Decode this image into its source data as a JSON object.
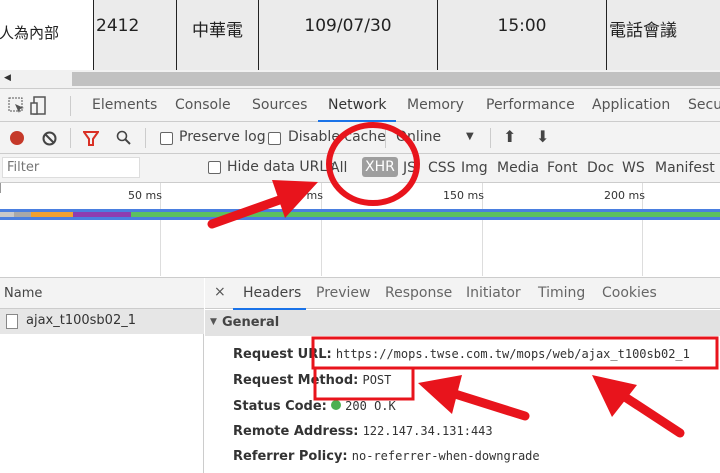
{
  "page_table": {
    "cells": [
      "人為內部",
      "2412",
      "中華電",
      "109/07/30",
      "15:00",
      "電話會議"
    ]
  },
  "devtools": {
    "tabs": [
      "Elements",
      "Console",
      "Sources",
      "Network",
      "Memory",
      "Performance",
      "Application",
      "Secur"
    ],
    "active_tab": "Network",
    "toolbar": {
      "preserve_log": "Preserve log",
      "disable_cache": "Disable cache",
      "throttle": "Online"
    },
    "filter": {
      "placeholder": "Filter",
      "hide_data_urls": "Hide data URLs",
      "types": [
        "All",
        "XHR",
        "JS",
        "CSS",
        "Img",
        "Media",
        "Font",
        "Doc",
        "WS",
        "Manifest"
      ],
      "active_type": "XHR"
    },
    "timeline": {
      "ticks": [
        "50 ms",
        "100 ms",
        "150 ms",
        "200 ms"
      ]
    },
    "requests": {
      "header": "Name",
      "items": [
        "ajax_t100sb02_1"
      ]
    },
    "detail_tabs": [
      "Headers",
      "Preview",
      "Response",
      "Initiator",
      "Timing",
      "Cookies"
    ],
    "general": {
      "title": "General",
      "rows": [
        {
          "label": "Request URL:",
          "value": "https://mops.twse.com.tw/mops/web/ajax_t100sb02_1"
        },
        {
          "label": "Request Method:",
          "value": "POST"
        },
        {
          "label": "Status Code:",
          "value": "200 O.K"
        },
        {
          "label": "Remote Address:",
          "value": "122.147.34.131:443"
        },
        {
          "label": "Referrer Policy:",
          "value": "no-referrer-when-downgrade"
        }
      ]
    }
  },
  "colors": {
    "accent": "#1a73e8",
    "annotation": "#e8141c",
    "record": "#c53929",
    "status_ok": "#4caf50"
  }
}
